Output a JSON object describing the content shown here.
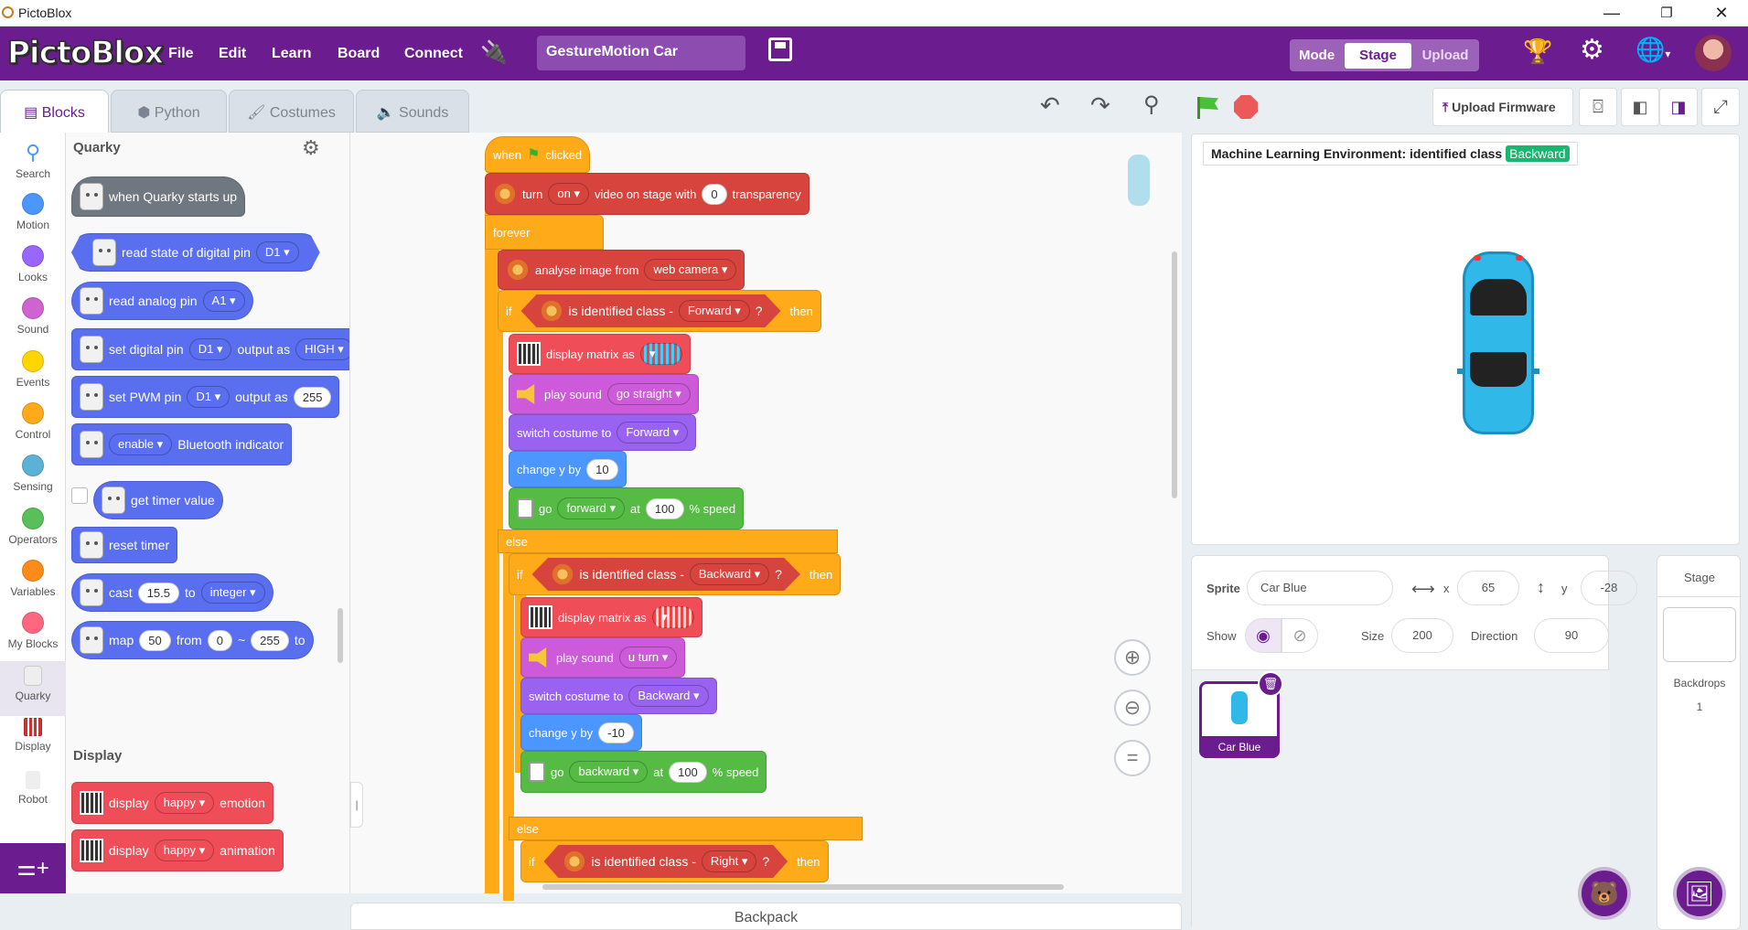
{
  "window": {
    "title": "PictoBlox",
    "minimize": "—",
    "maximize": "❐",
    "close": "✕"
  },
  "menu": {
    "logo": "PictoBlox",
    "items": [
      "File",
      "Edit",
      "Learn",
      "Board",
      "Connect"
    ],
    "project_name": "GestureMotion Car",
    "mode_label": "Mode",
    "mode_stage": "Stage",
    "mode_upload": "Upload"
  },
  "tabs": {
    "blocks": "Blocks",
    "python": "Python",
    "costumes": "Costumes",
    "sounds": "Sounds"
  },
  "categories": [
    {
      "name": "Search",
      "color": "#4c97ff"
    },
    {
      "name": "Motion",
      "color": "#4c97ff"
    },
    {
      "name": "Looks",
      "color": "#9966ff"
    },
    {
      "name": "Sound",
      "color": "#cf63cf"
    },
    {
      "name": "Events",
      "color": "#ffd500"
    },
    {
      "name": "Control",
      "color": "#ffab19"
    },
    {
      "name": "Sensing",
      "color": "#5cb1d6"
    },
    {
      "name": "Operators",
      "color": "#59c059"
    },
    {
      "name": "Variables",
      "color": "#ff8c1a"
    },
    {
      "name": "My Blocks",
      "color": "#ff6680"
    },
    {
      "name": "Quarky",
      "color": "#9966ff"
    },
    {
      "name": "Display",
      "color": "#ef4d58"
    },
    {
      "name": "Robot",
      "color": "#55bb44"
    }
  ],
  "palette": {
    "section_quarky": "Quarky",
    "section_display": "Display",
    "b1": "when Quarky starts up",
    "b2a": "read state of digital pin",
    "b2b": "D1",
    "b3a": "read analog pin",
    "b3b": "A1",
    "b4a": "set digital pin",
    "b4b": "D1",
    "b4c": "output as",
    "b4d": "HIGH",
    "b5a": "set PWM pin",
    "b5b": "D1",
    "b5c": "output as",
    "b5d": "255",
    "b6a": "enable",
    "b6b": "Bluetooth indicator",
    "b7": "get timer value",
    "b8": "reset timer",
    "b9a": "cast",
    "b9b": "15.5",
    "b9c": "to",
    "b9d": "integer",
    "b10a": "map",
    "b10b": "50",
    "b10c": "from",
    "b10d": "0",
    "b10e": "~",
    "b10f": "255",
    "b10g": "to",
    "b11a": "display",
    "b11b": "happy",
    "b11c": "emotion",
    "b12a": "display",
    "b12b": "happy",
    "b12c": "animation"
  },
  "script": {
    "hat_when": "when",
    "hat_clicked": "clicked",
    "turn": "turn",
    "turn_on": "on",
    "turn_mid": "video on stage with",
    "turn_val": "0",
    "turn_end": "transparency",
    "forever": "forever",
    "analyse": "analyse image from",
    "analyse_src": "web camera",
    "if1": "if",
    "then": "then",
    "identified": "is identified class -",
    "forward": "Forward",
    "q": "?",
    "disp_matrix": "display matrix as",
    "play_sound": "play sound",
    "snd1": "go straight",
    "switch_costume": "switch costume to",
    "cos1": "Forward",
    "change_y": "change y by",
    "dy1": "10",
    "go": "go",
    "dir1": "forward",
    "at": "at",
    "speed1": "100",
    "pct_speed": "% speed",
    "else": "else",
    "backward": "Backward",
    "snd2": "u turn",
    "cos2": "Backward",
    "dy2": "-10",
    "dir2": "backward",
    "speed2": "100",
    "right": "Right"
  },
  "stage": {
    "toolbar_upload": "Upload Firmware",
    "ml_label": "Machine Learning Environment: identified class",
    "ml_class": "Backward"
  },
  "sprite": {
    "label_sprite": "Sprite",
    "name": "Car Blue",
    "label_x": "x",
    "x": "65",
    "label_y": "y",
    "y": "-28",
    "label_show": "Show",
    "label_size": "Size",
    "size": "200",
    "label_direction": "Direction",
    "direction": "90",
    "thumb_name": "Car Blue"
  },
  "stage_panel": {
    "title": "Stage",
    "backdrops_label": "Backdrops",
    "backdrops_count": "1"
  },
  "backpack": "Backpack"
}
